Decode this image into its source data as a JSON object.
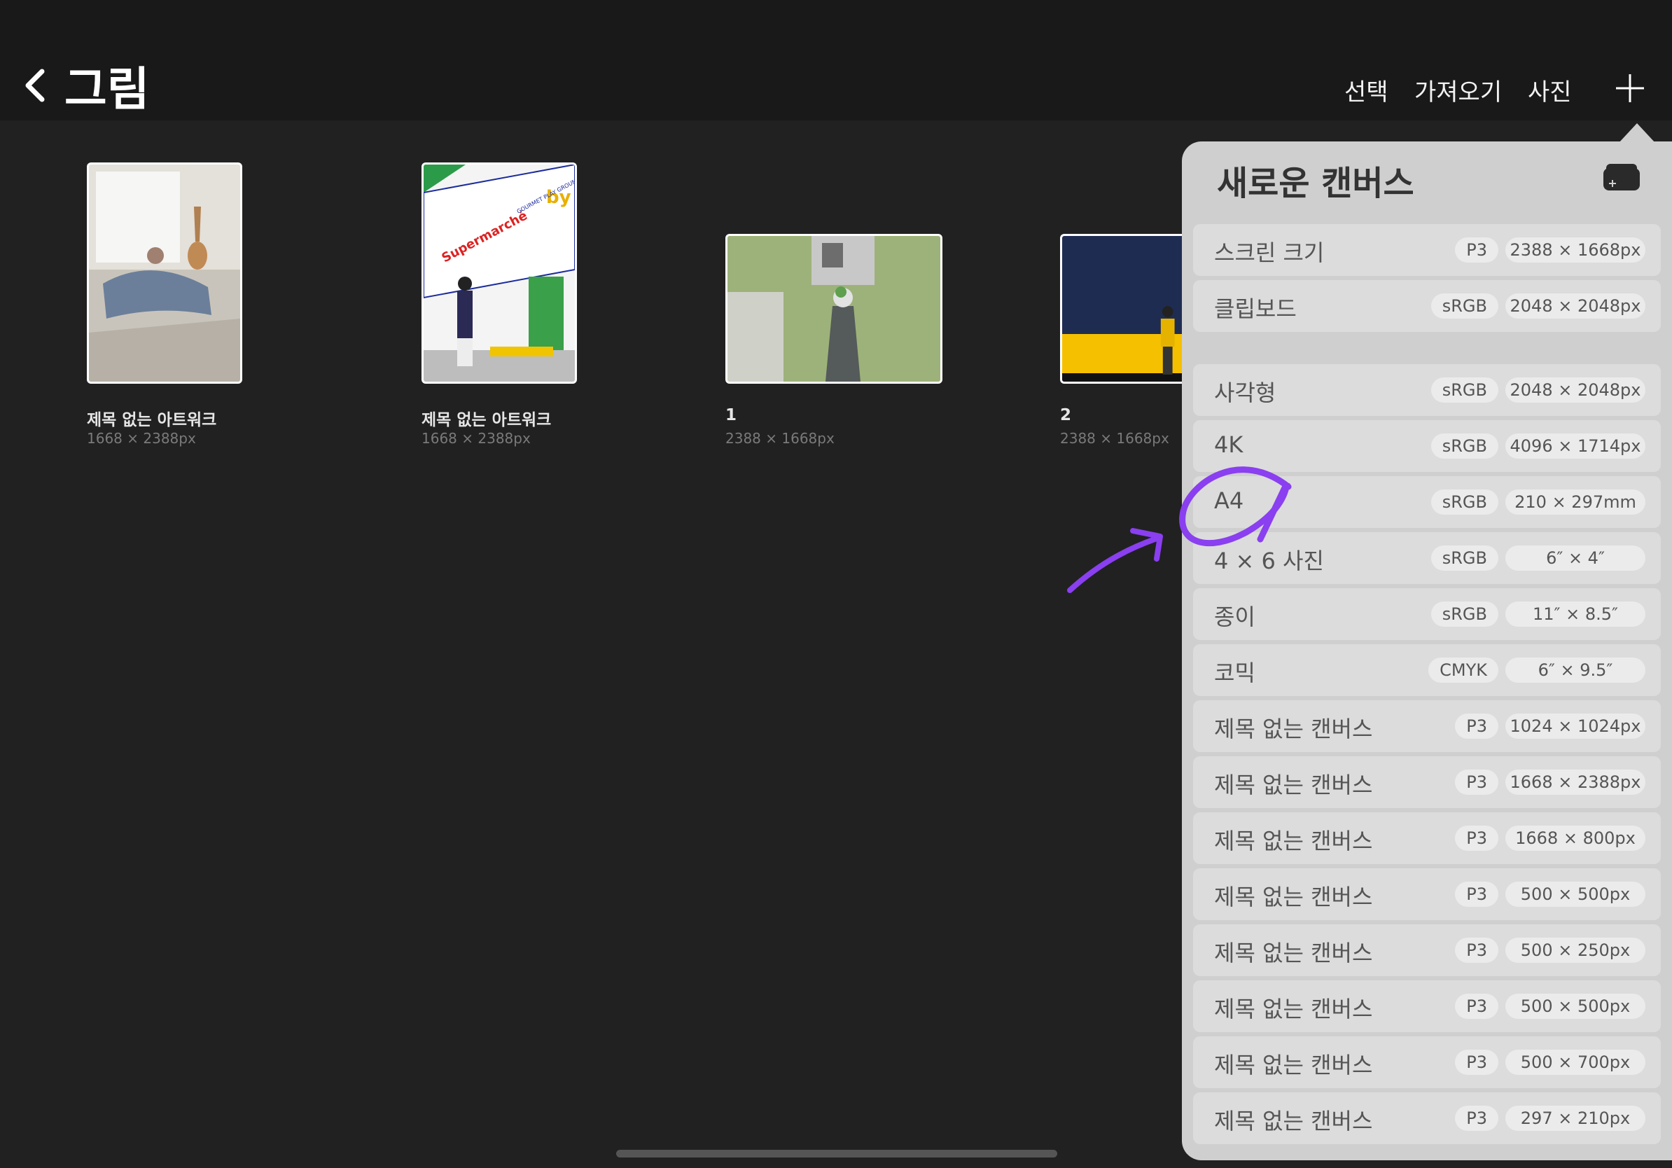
{
  "header": {
    "title": "그림",
    "buttons": {
      "select": "선택",
      "import": "가져오기",
      "photo": "사진"
    }
  },
  "gallery": [
    {
      "name": "제목 없는 아트워크",
      "size": "1668 × 2388px"
    },
    {
      "name": "제목 없는 아트워크",
      "size": "1668 × 2388px",
      "sign_text": "Supermarché",
      "sign_text_2": "by",
      "sign_text_3": "GOURMET PLAY GROUND"
    },
    {
      "name": "1",
      "size": "2388 × 1668px"
    },
    {
      "name": "2",
      "size": "2388 × 1668px"
    }
  ],
  "new_canvas": {
    "title": "새로운 캔버스",
    "rows": [
      {
        "label": "스크린 크기",
        "colorspace": "P3",
        "dims": "2388 × 1668px"
      },
      {
        "label": "클립보드",
        "colorspace": "sRGB",
        "dims": "2048 × 2048px"
      },
      {
        "label": "사각형",
        "colorspace": "sRGB",
        "dims": "2048 × 2048px"
      },
      {
        "label": "4K",
        "colorspace": "sRGB",
        "dims": "4096 × 1714px"
      },
      {
        "label": "A4",
        "colorspace": "sRGB",
        "dims": "210 × 297mm"
      },
      {
        "label": "4 × 6 사진",
        "colorspace": "sRGB",
        "dims": "6″ × 4″"
      },
      {
        "label": "종이",
        "colorspace": "sRGB",
        "dims": "11″ × 8.5″"
      },
      {
        "label": "코믹",
        "colorspace": "CMYK",
        "dims": "6″ × 9.5″"
      },
      {
        "label": "제목 없는 캔버스",
        "colorspace": "P3",
        "dims": "1024 × 1024px"
      },
      {
        "label": "제목 없는 캔버스",
        "colorspace": "P3",
        "dims": "1668 × 2388px"
      },
      {
        "label": "제목 없는 캔버스",
        "colorspace": "P3",
        "dims": "1668 × 800px"
      },
      {
        "label": "제목 없는 캔버스",
        "colorspace": "P3",
        "dims": "500 × 500px"
      },
      {
        "label": "제목 없는 캔버스",
        "colorspace": "P3",
        "dims": "500 × 250px"
      },
      {
        "label": "제목 없는 캔버스",
        "colorspace": "P3",
        "dims": "500 × 500px"
      },
      {
        "label": "제목 없는 캔버스",
        "colorspace": "P3",
        "dims": "500 × 700px"
      },
      {
        "label": "제목 없는 캔버스",
        "colorspace": "P3",
        "dims": "297 × 210px"
      }
    ]
  },
  "colors": {
    "annotation": "#8a3ff0",
    "background": "#212121",
    "topbar": "#191919",
    "popover": "#cfcfcf"
  }
}
